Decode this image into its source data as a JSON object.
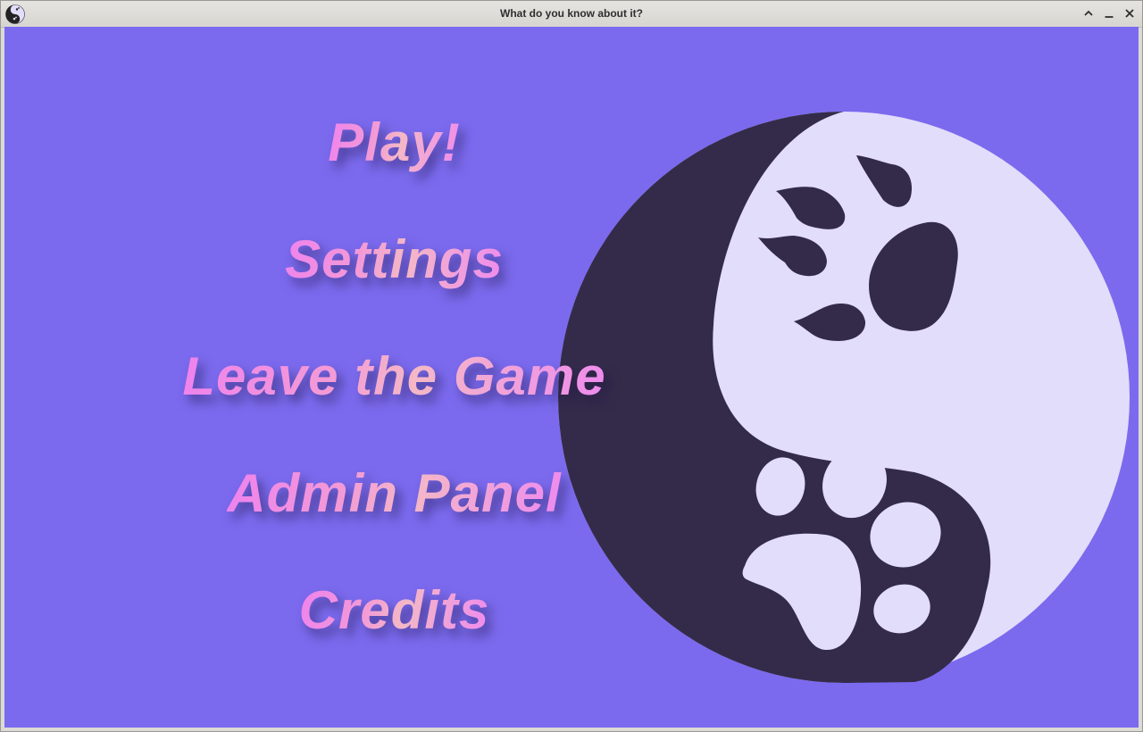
{
  "window": {
    "title": "What do you know about it?"
  },
  "menu": {
    "items": [
      {
        "id": "play",
        "label": "Play!"
      },
      {
        "id": "settings",
        "label": "Settings"
      },
      {
        "id": "leave",
        "label": "Leave the Game"
      },
      {
        "id": "admin",
        "label": "Admin Panel"
      },
      {
        "id": "credits",
        "label": "Credits"
      }
    ]
  },
  "colors": {
    "background": "#7b6aee",
    "menu_text": "#ee82ee",
    "emblem_dark": "#342b4a",
    "emblem_light": "#e2ddfb"
  },
  "icons": {
    "app": "yin-yang-paw-icon",
    "emblem": "yin-yang-paw-emblem",
    "maximize": "chevron-up-icon",
    "minimize": "minimize-icon",
    "close": "close-icon"
  }
}
